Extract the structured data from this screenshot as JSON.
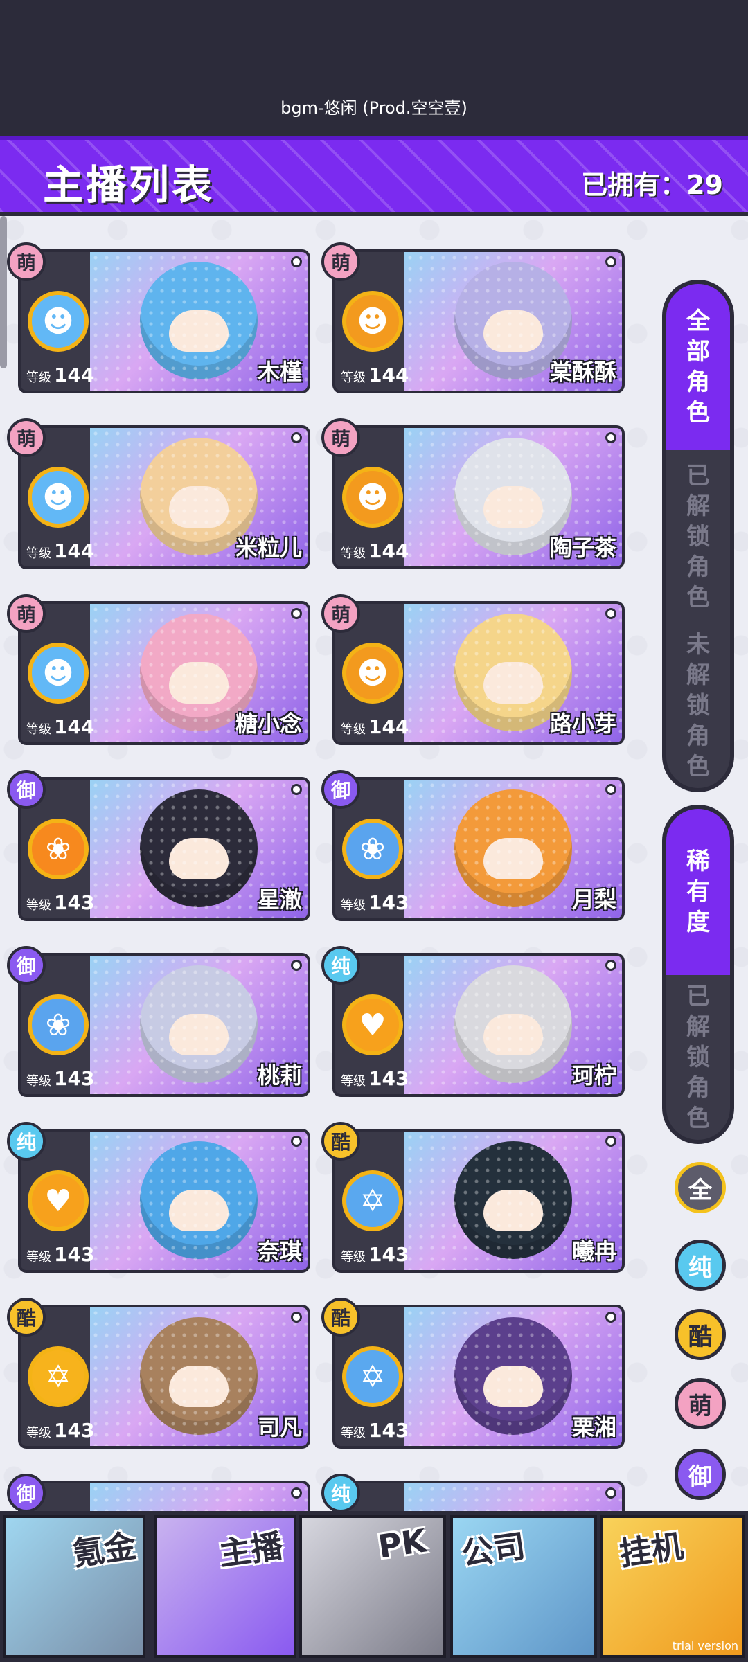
{
  "top": {
    "bgm": "bgm-悠闲 (Prod.空空壹)"
  },
  "header": {
    "title": "主播列表",
    "owned": "已拥有：29"
  },
  "level_label": "等级",
  "cards": [
    {
      "name": "木槿",
      "level": "144",
      "type": "萌"
    },
    {
      "name": "棠酥酥",
      "level": "144",
      "type": "萌"
    },
    {
      "name": "米粒儿",
      "level": "144",
      "type": "萌"
    },
    {
      "name": "陶子茶",
      "level": "144",
      "type": "萌"
    },
    {
      "name": "糖小念",
      "level": "144",
      "type": "萌"
    },
    {
      "name": "路小芽",
      "level": "144",
      "type": "萌"
    },
    {
      "name": "星澈",
      "level": "143",
      "type": "御"
    },
    {
      "name": "月梨",
      "level": "143",
      "type": "御"
    },
    {
      "name": "桃莉",
      "level": "143",
      "type": "御"
    },
    {
      "name": "珂柠",
      "level": "143",
      "type": "纯"
    },
    {
      "name": "奈琪",
      "level": "143",
      "type": "纯"
    },
    {
      "name": "曦冉",
      "level": "143",
      "type": "酷"
    },
    {
      "name": "司凡",
      "level": "143",
      "type": "酷"
    },
    {
      "name": "栗湘",
      "level": "143",
      "type": "酷"
    },
    {
      "name": "",
      "level": "",
      "type": "御"
    },
    {
      "name": "",
      "level": "",
      "type": "纯"
    }
  ],
  "filters": {
    "role": [
      "全部角色",
      "已解锁角色",
      "未解锁角色"
    ],
    "rarity": [
      "稀有度",
      "已解锁角色"
    ],
    "types": [
      "全",
      "纯",
      "酷",
      "萌",
      "御"
    ]
  },
  "nav": [
    "氪金",
    "主播",
    "PK",
    "公司",
    "挂机"
  ],
  "trial": "trial version",
  "colors": {
    "accent": "#7b2bf0",
    "dark": "#2c2b3a"
  }
}
